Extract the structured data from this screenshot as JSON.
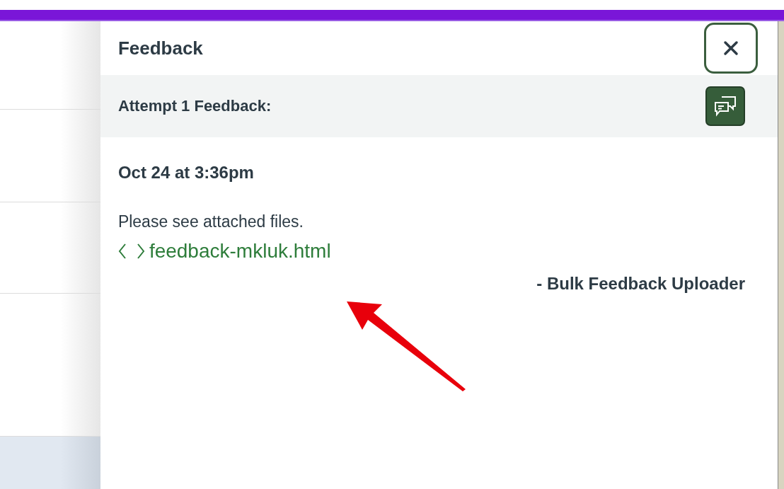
{
  "panel": {
    "title": "Feedback"
  },
  "attempt": {
    "heading": "Attempt 1 Feedback:"
  },
  "comments": [
    {
      "date": "Oct 24 at 3:36pm",
      "text": "Please see attached files.",
      "attachments": [
        {
          "name": "feedback-mkluk.html"
        }
      ],
      "author": "- Bulk Feedback Uploader"
    }
  ]
}
